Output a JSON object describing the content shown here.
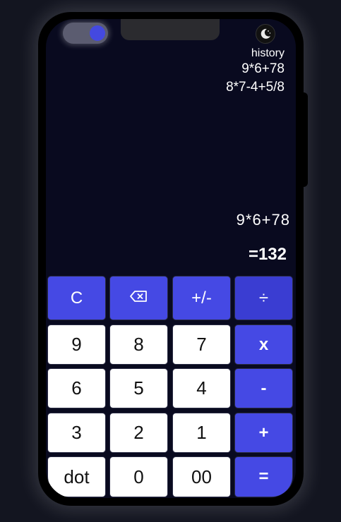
{
  "header": {
    "toggle_accent": "#4449e0",
    "theme_icon": "moon-icon"
  },
  "history": {
    "title": "history",
    "items": [
      "9*6+78",
      "8*7-4+5/8"
    ]
  },
  "display": {
    "expression": "9*6+78",
    "result": "=132"
  },
  "keypad": {
    "clear": "C",
    "backspace_icon": "backspace-icon",
    "sign": "+/-",
    "divide": "÷",
    "nine": "9",
    "eight": "8",
    "seven": "7",
    "multiply": "x",
    "six": "6",
    "five": "5",
    "four": "4",
    "minus": "-",
    "three": "3",
    "two": "2",
    "one": "1",
    "plus": "+",
    "dot": "dot",
    "zero": "0",
    "double_zero": "00",
    "equals": "="
  },
  "colors": {
    "accent": "#4549e4",
    "screen_bg": "#090a1f",
    "page_bg": "#131520"
  }
}
